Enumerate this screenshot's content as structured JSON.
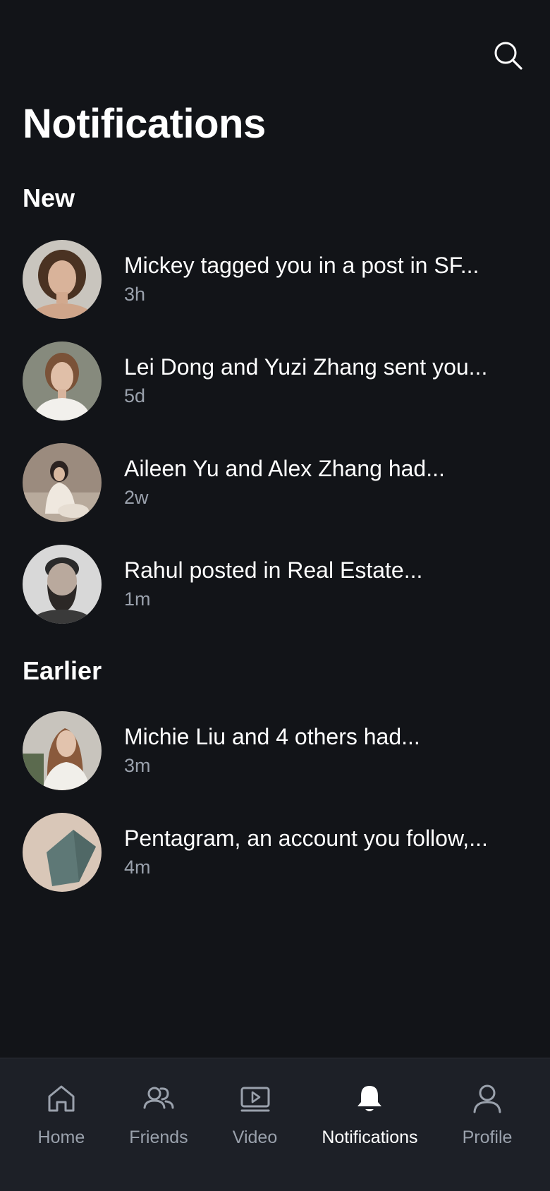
{
  "header": {
    "title": "Notifications",
    "search_icon": "search-icon"
  },
  "sections": [
    {
      "title": "New",
      "items": [
        {
          "message": "Mickey tagged you in a post in SF...",
          "time": "3h",
          "avatar": "woman-curly-hair-portrait"
        },
        {
          "message": "Lei Dong and Yuzi Zhang sent you...",
          "time": "5d",
          "avatar": "woman-white-shirt-portrait"
        },
        {
          "message": "Aileen Yu and Alex Zhang had...",
          "time": "2w",
          "avatar": "woman-sitting-portrait"
        },
        {
          "message": "Rahul posted in Real Estate...",
          "time": "1m",
          "avatar": "bearded-man-portrait"
        }
      ]
    },
    {
      "title": "Earlier",
      "items": [
        {
          "message": "Michie Liu and 4 others had...",
          "time": "3m",
          "avatar": "woman-long-hair-portrait"
        },
        {
          "message": "Pentagram, an account you follow,...",
          "time": "4m",
          "avatar": "pentagram-logo"
        }
      ]
    }
  ],
  "tabbar": {
    "tabs": [
      {
        "label": "Home",
        "icon": "home-icon",
        "active": false
      },
      {
        "label": "Friends",
        "icon": "friends-icon",
        "active": false
      },
      {
        "label": "Video",
        "icon": "video-icon",
        "active": false
      },
      {
        "label": "Notifications",
        "icon": "bell-icon",
        "active": true
      },
      {
        "label": "Profile",
        "icon": "profile-icon",
        "active": false
      }
    ]
  },
  "colors": {
    "background": "#121418",
    "tabbar_background": "#1d2027",
    "text_primary": "#ffffff",
    "text_secondary": "#9aa1ac"
  }
}
